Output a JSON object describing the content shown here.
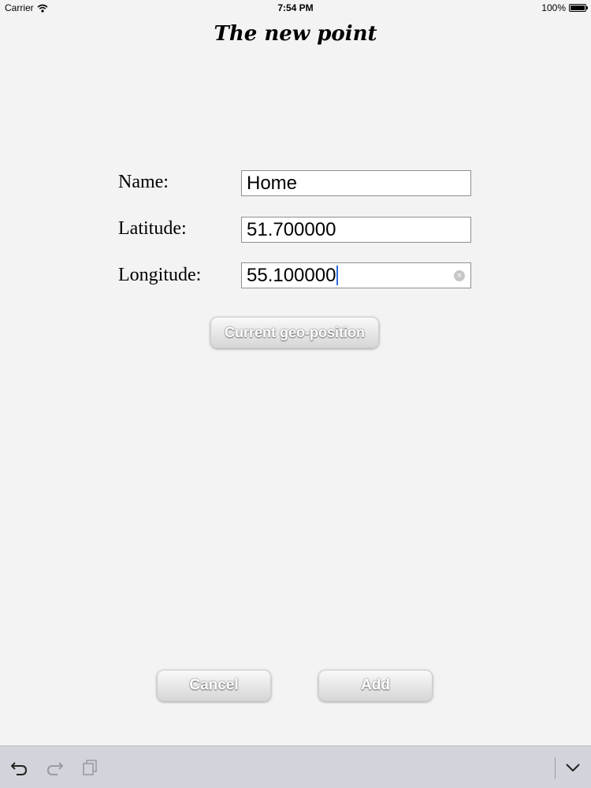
{
  "status_bar": {
    "carrier": "Carrier",
    "time": "7:54 PM",
    "battery": "100%",
    "battery_level": 1.0
  },
  "title": "The new point",
  "form": {
    "name_label": "Name:",
    "name_value": "Home",
    "latitude_label": "Latitude:",
    "latitude_value": "51.700000",
    "longitude_label": "Longitude:",
    "longitude_value": "55.100000"
  },
  "buttons": {
    "geo_label": "Current geo-position",
    "cancel_label": "Cancel",
    "add_label": "Add"
  },
  "toolbar": {
    "icons": [
      "undo-icon",
      "redo-icon",
      "paste-icon",
      "chevron-down-icon"
    ]
  }
}
